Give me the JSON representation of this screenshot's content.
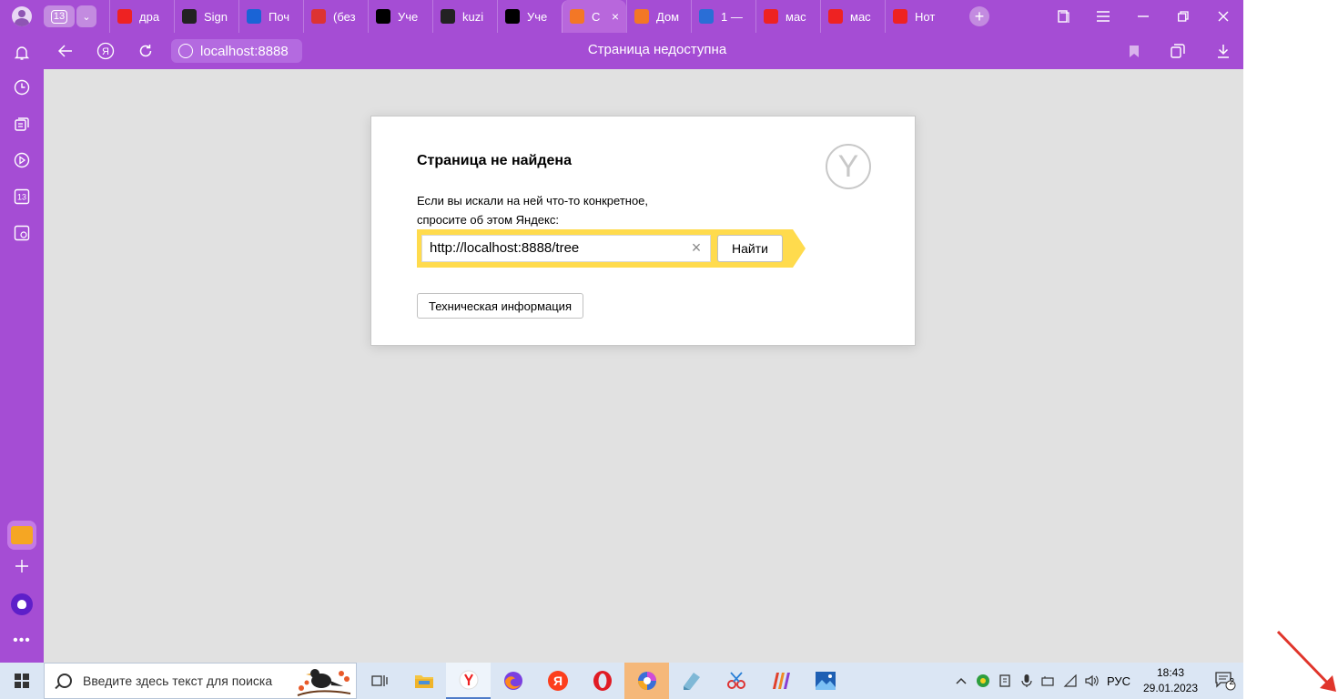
{
  "browser": {
    "tab_count": "13",
    "tabs": [
      {
        "label": "дра",
        "icon": "yandex-icon",
        "color": "#e22"
      },
      {
        "label": "Sign",
        "icon": "github-icon",
        "color": "#222"
      },
      {
        "label": "Поч",
        "icon": "mail-icon",
        "color": "#1a64d6"
      },
      {
        "label": "(без",
        "icon": "gmail-icon",
        "color": "#d33"
      },
      {
        "label": "Уче",
        "icon": "jetbrains-icon",
        "color": "#000"
      },
      {
        "label": "kuzi",
        "icon": "github-icon",
        "color": "#222"
      },
      {
        "label": "Уче",
        "icon": "jetbrains-icon",
        "color": "#000"
      },
      {
        "label": "С",
        "icon": "jupyter-icon",
        "color": "#f37726",
        "active": true
      },
      {
        "label": "Дом",
        "icon": "jupyter-icon",
        "color": "#f37726"
      },
      {
        "label": "1 —",
        "icon": "colab-icon",
        "color": "#2a6ed6"
      },
      {
        "label": "мас",
        "icon": "yandex-icon",
        "color": "#e22"
      },
      {
        "label": "мас",
        "icon": "yandex-icon",
        "color": "#e22"
      },
      {
        "label": "Нот",
        "icon": "yandex-icon",
        "color": "#e22"
      }
    ],
    "address": {
      "url": "localhost:8888",
      "page_title": "Страница недоступна"
    }
  },
  "error_page": {
    "heading": "Страница не найдена",
    "description_line1": "Если вы искали на ней что-то конкретное,",
    "description_line2": "спросите об этом Яндекс:",
    "search_value": "http://localhost:8888/tree",
    "search_button": "Найти",
    "tech_button": "Техническая информация",
    "logo_letter": "Y"
  },
  "taskbar": {
    "search_placeholder": "Введите здесь текст для поиска",
    "language": "РУС",
    "time": "18:43",
    "date": "29.01.2023",
    "notifications": "2"
  },
  "colors": {
    "browser_accent": "#a54dd4",
    "search_yellow": "#ffdb4d",
    "page_bg": "#e1e1e1",
    "annotation_arrow": "#e0352b"
  }
}
